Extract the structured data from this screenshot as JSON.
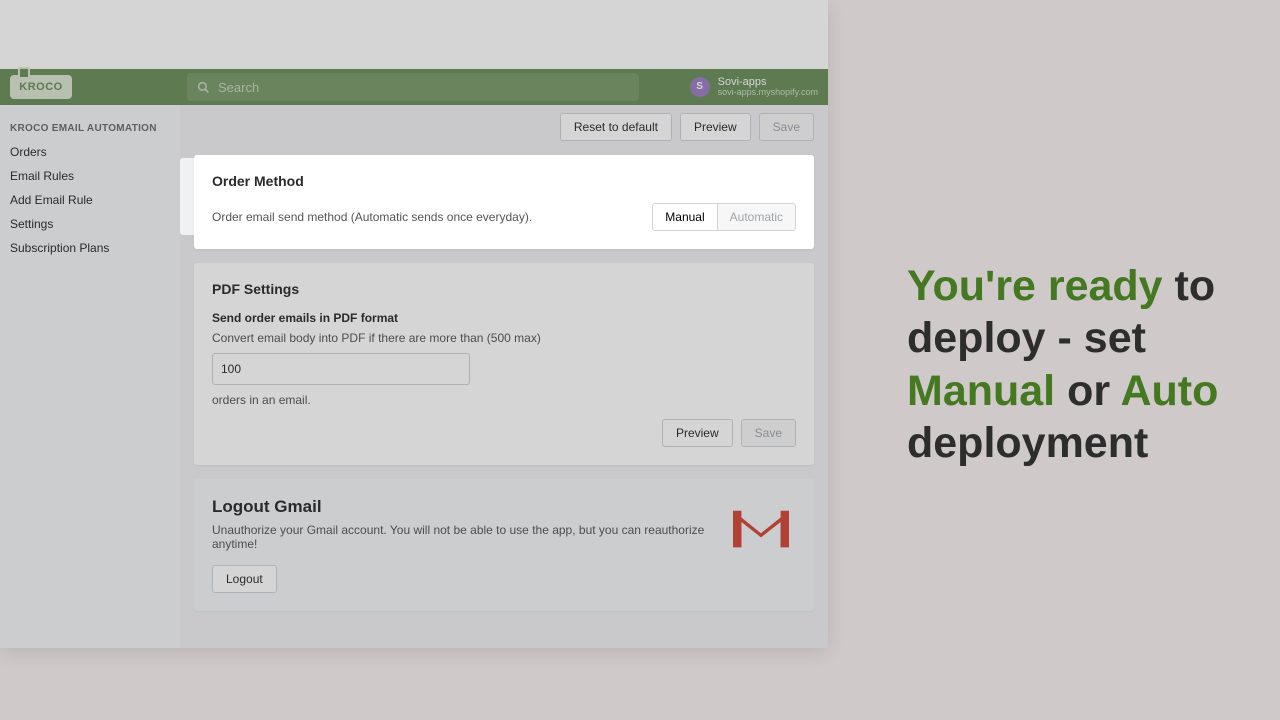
{
  "header": {
    "logo_text": "KROCO",
    "search_placeholder": "Search",
    "user_name": "Sovi-apps",
    "user_sub": "sovi-apps.myshopify.com",
    "avatar_letter": "S"
  },
  "sidebar": {
    "heading": "KROCO EMAIL AUTOMATION",
    "items": [
      {
        "label": "Orders"
      },
      {
        "label": "Email Rules"
      },
      {
        "label": "Add Email Rule"
      },
      {
        "label": "Settings"
      },
      {
        "label": "Subscription Plans"
      }
    ]
  },
  "top_buttons": {
    "reset": "Reset to default",
    "preview": "Preview",
    "save": "Save"
  },
  "order_method": {
    "title": "Order Method",
    "desc": "Order email send method (Automatic sends once everyday).",
    "manual": "Manual",
    "automatic": "Automatic"
  },
  "pdf": {
    "title": "PDF Settings",
    "sub": "Send order emails in PDF format",
    "desc": "Convert email body into PDF if there are more than (500 max)",
    "value": "100",
    "suffix": "orders in an email.",
    "preview": "Preview",
    "save": "Save"
  },
  "gmail": {
    "title": "Logout Gmail",
    "desc": "Unauthorize your Gmail account. You will not be able to use the app, but you can reauthorize anytime!",
    "logout": "Logout"
  },
  "headline": {
    "p1": "You're ready",
    "p2": " to deploy - set ",
    "p3": "Manual",
    "p4": " or ",
    "p5": "Auto",
    "p6": " deployment"
  }
}
